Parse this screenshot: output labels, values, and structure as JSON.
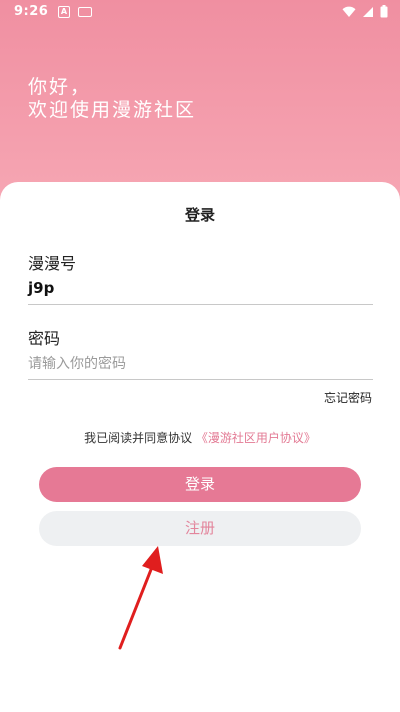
{
  "status_bar": {
    "time": "9:26",
    "notif_icon_letter": "A"
  },
  "greeting": {
    "line1": "你好，",
    "line2": "欢迎使用漫游社区"
  },
  "login_card": {
    "title": "登录",
    "account": {
      "label": "漫漫号",
      "value": "j9p"
    },
    "password": {
      "label": "密码",
      "placeholder": "请输入你的密码"
    },
    "forgot_password": "忘记密码",
    "agreement": {
      "text": "我已阅读并同意协议",
      "link": "《漫游社区用户协议》"
    },
    "login_button": "登录",
    "register_button": "注册"
  },
  "colors": {
    "accent": "#e67995",
    "header_pink": "#f5a0b0",
    "register_bg": "#eef0f2",
    "arrow_red": "#e01e1e"
  }
}
